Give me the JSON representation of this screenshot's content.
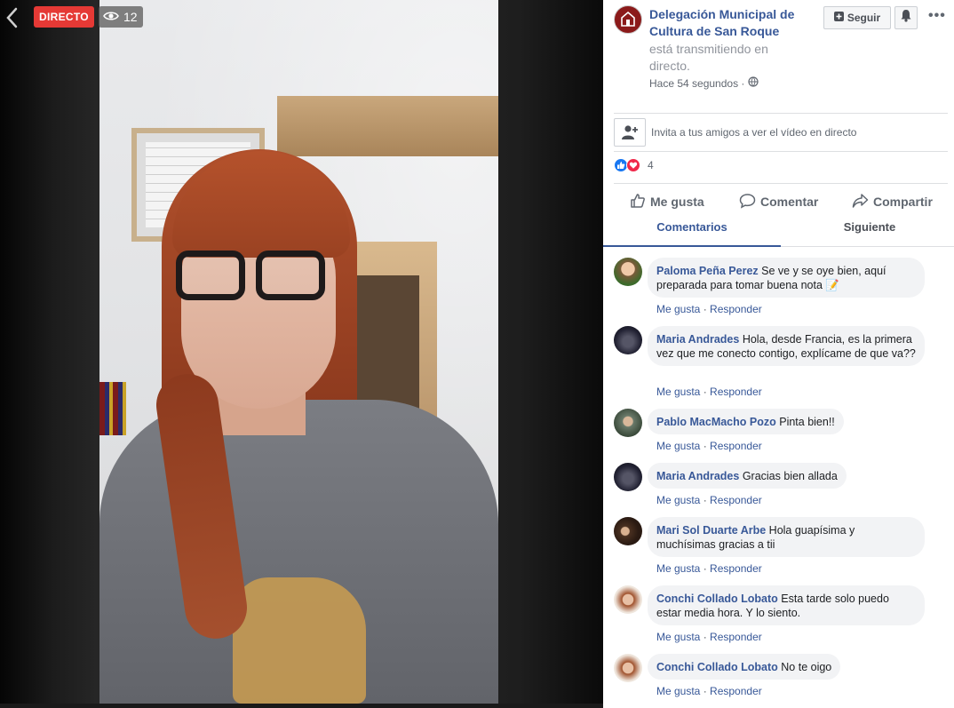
{
  "video": {
    "live_label": "DIRECTO",
    "viewers": "12"
  },
  "page": {
    "name": "Delegación Municipal de Cultura de San Roque",
    "status": "está transmitiendo en directo.",
    "time": "Hace 54 segundos ·",
    "follow_label": "Seguir"
  },
  "invite": {
    "text": "Invita a tus amigos a ver el vídeo en directo"
  },
  "reactions": {
    "count": "4"
  },
  "actions": {
    "like": "Me gusta",
    "comment": "Comentar",
    "share": "Compartir"
  },
  "tabs": {
    "comments": "Comentarios",
    "next": "Siguiente"
  },
  "comments": [
    {
      "author": "Paloma Peña Perez",
      "text": "Se ve y se oye bien, aquí preparada para tomar buena nota 📝",
      "like": "Me gusta",
      "reply": "Responder"
    },
    {
      "author": "Maria Andrades",
      "text": "Hola, desde Francia, es la primera vez que me conecto contigo, explícame de que va??",
      "like": "Me gusta",
      "reply": "Responder"
    },
    {
      "author": "Pablo MacMacho Pozo",
      "text": "Pinta bien!!",
      "like": "Me gusta",
      "reply": "Responder"
    },
    {
      "author": "Maria Andrades",
      "text": "Gracias bien allada",
      "like": "Me gusta",
      "reply": "Responder"
    },
    {
      "author": "Mari Sol Duarte Arbe",
      "text": "Hola guapísima y muchísimas gracias a tii",
      "like": "Me gusta",
      "reply": "Responder"
    },
    {
      "author": "Conchi Collado Lobato",
      "text": "Esta tarde solo puedo estar media hora. Y lo siento.",
      "like": "Me gusta",
      "reply": "Responder"
    },
    {
      "author": "Conchi Collado Lobato",
      "text": "No te oigo",
      "like": "Me gusta",
      "reply": "Responder"
    }
  ],
  "colors": {
    "link": "#385898",
    "live": "#e53935",
    "bubble": "#f2f3f5"
  }
}
